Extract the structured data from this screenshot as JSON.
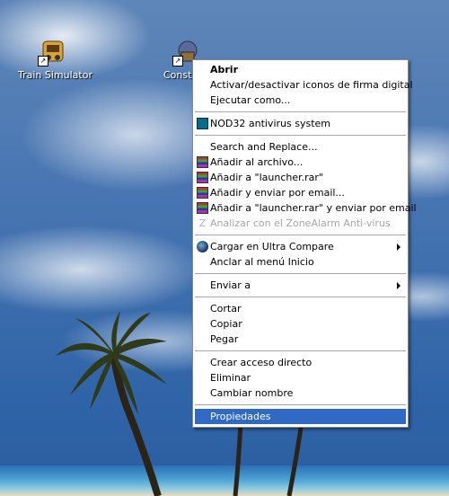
{
  "desktop": {
    "icons": [
      {
        "label": "Train Simulator",
        "icon": "train-simulator-icon"
      },
      {
        "label": "Constr",
        "icon": "construction-app-icon"
      }
    ]
  },
  "context_menu": {
    "groups": [
      [
        {
          "label": "Abrir",
          "bold": true
        },
        {
          "label": "Activar/desactivar iconos de firma digital"
        },
        {
          "label": "Ejecutar como..."
        }
      ],
      [
        {
          "label": "NOD32 antivirus system",
          "icon": "nod32-icon"
        }
      ],
      [
        {
          "label": "Search and Replace..."
        },
        {
          "label": "Añadir al archivo...",
          "icon": "winrar-icon"
        },
        {
          "label": "Añadir a \"launcher.rar\"",
          "icon": "winrar-icon"
        },
        {
          "label": "Añadir y enviar por email...",
          "icon": "winrar-icon"
        },
        {
          "label": "Añadir a \"launcher.rar\" y enviar por email",
          "icon": "winrar-icon"
        },
        {
          "label": "Analizar con el ZoneAlarm Anti-virus",
          "icon": "zonealarm-icon",
          "disabled": true
        }
      ],
      [
        {
          "label": "Cargar en Ultra Compare",
          "icon": "ultracompare-icon",
          "submenu": true
        },
        {
          "label": "Anclar al menú Inicio"
        }
      ],
      [
        {
          "label": "Enviar a",
          "submenu": true
        }
      ],
      [
        {
          "label": "Cortar"
        },
        {
          "label": "Copiar"
        },
        {
          "label": "Pegar"
        }
      ],
      [
        {
          "label": "Crear acceso directo"
        },
        {
          "label": "Eliminar"
        },
        {
          "label": "Cambiar nombre"
        }
      ],
      [
        {
          "label": "Propiedades",
          "selected": true
        }
      ]
    ]
  },
  "colors": {
    "selection": "#316ac5",
    "menu_bg": "#ffffff",
    "disabled_text": "#a5a5a5"
  }
}
